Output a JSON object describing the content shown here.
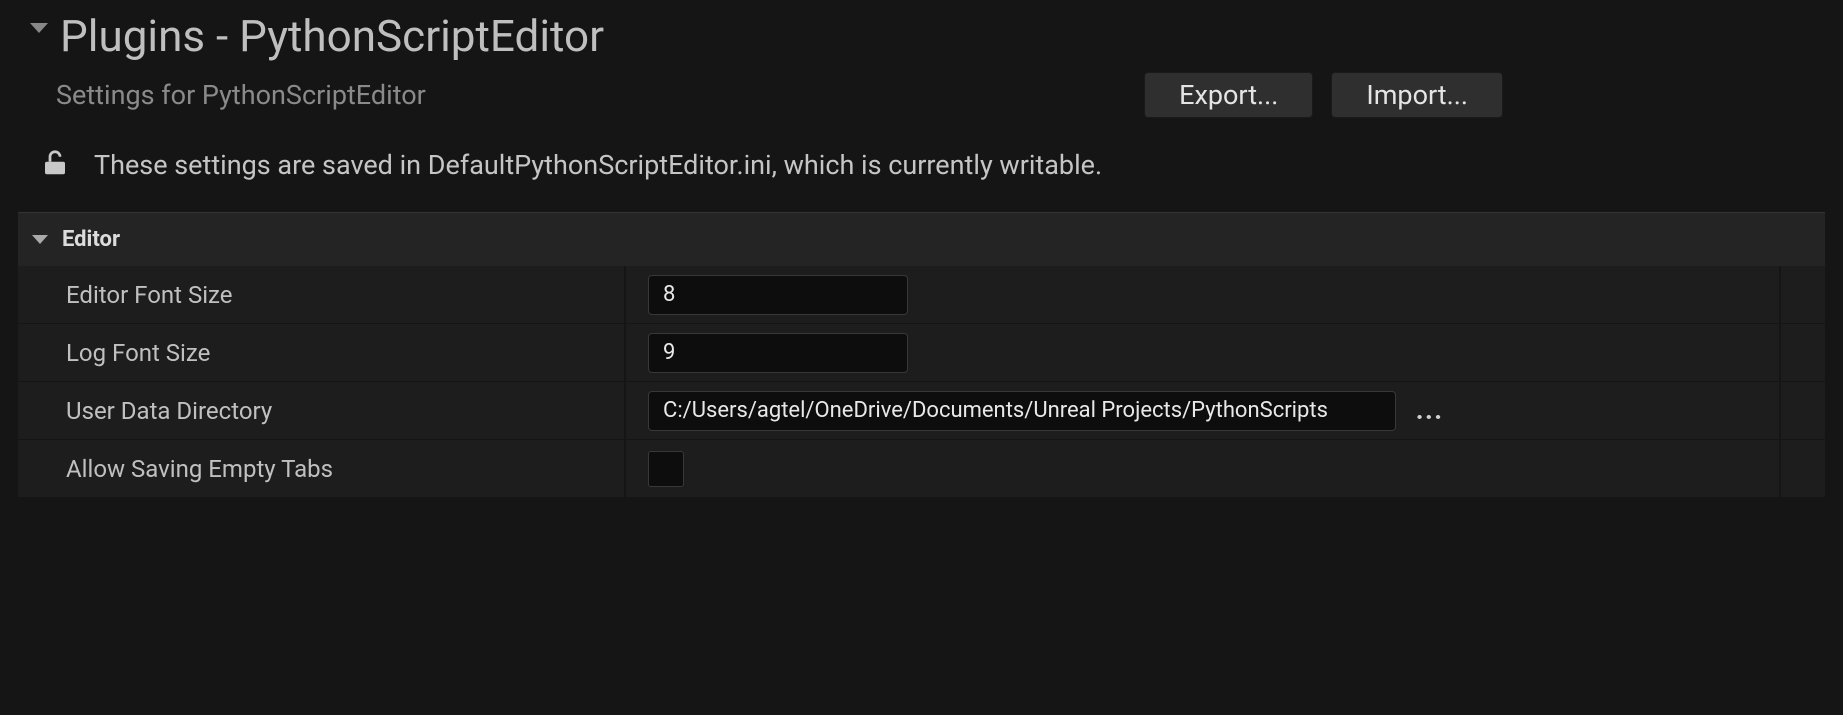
{
  "header": {
    "title": "Plugins - PythonScriptEditor",
    "subtitle": "Settings for PythonScriptEditor",
    "buttons": {
      "export": "Export...",
      "import": "Import..."
    }
  },
  "status": {
    "text": "These settings are saved in DefaultPythonScriptEditor.ini, which is currently writable."
  },
  "section": {
    "title": "Editor",
    "props": {
      "editor_font_size": {
        "label": "Editor Font Size",
        "value": "8"
      },
      "log_font_size": {
        "label": "Log Font Size",
        "value": "9"
      },
      "user_data_dir": {
        "label": "User Data Directory",
        "value": "C:/Users/agtel/OneDrive/Documents/Unreal Projects/PythonScripts"
      },
      "allow_empty_tabs": {
        "label": "Allow Saving Empty Tabs",
        "checked": false
      }
    }
  }
}
